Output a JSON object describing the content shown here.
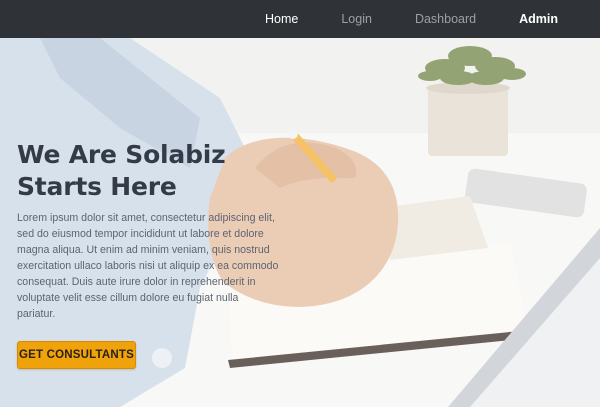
{
  "nav": {
    "items": [
      {
        "label": "Home",
        "active": true
      },
      {
        "label": "Login",
        "active": false
      },
      {
        "label": "Dashboard",
        "active": false
      },
      {
        "label": "Admin",
        "active": false
      }
    ]
  },
  "hero": {
    "title_line1_prefix": "We Are ",
    "title_brand": "Solabiz",
    "title_line2": "Starts Here",
    "body": "Lorem ipsum dolor sit amet, consectetur adipiscing elit, sed do eiusmod tempor incididunt ut labore et dolore magna aliqua. Ut enim ad minim veniam, quis nostrud exercitation ullaco laboris nisi ut aliquip ex ea commodo consequat. Duis aute irure dolor in reprehenderit in voluptate velit esse cillum dolore eu fugiat nulla pariatur.",
    "cta_label": "GET CONSULTANTS"
  },
  "colors": {
    "navbar_bg": "#2f3338",
    "cta_bg": "#f0a20b",
    "title_color": "#343b48"
  }
}
